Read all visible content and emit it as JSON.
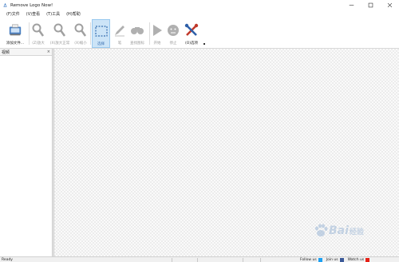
{
  "window": {
    "title": "Remove Logo Now!"
  },
  "menu": {
    "items": [
      "(F)文件",
      "(V)查看",
      "(T)工具",
      "(H)帮助"
    ]
  },
  "toolbar": {
    "add_file": "添加文件...",
    "zoom_in": "(Z)放大",
    "fit_zoom": "(X)放大正常",
    "zoom_out": "(X)缩小",
    "select": "选择",
    "pen": "笔",
    "find_logo": "查找图标",
    "start": "开始",
    "stop": "停止",
    "options": "(O)选项"
  },
  "left_panel": {
    "title": "视频",
    "close": "×"
  },
  "status": {
    "text": "Ready",
    "follow": "Follow us",
    "join": "Join us",
    "watch": "Watch us"
  },
  "watermark": {
    "text": "Bai",
    "suffix": "经验"
  },
  "colors": {
    "selected_bg": "#cce4f7",
    "selected_border": "#99c9ef",
    "twitter": "#1da1f2",
    "facebook": "#3b5998",
    "youtube": "#e62117"
  }
}
